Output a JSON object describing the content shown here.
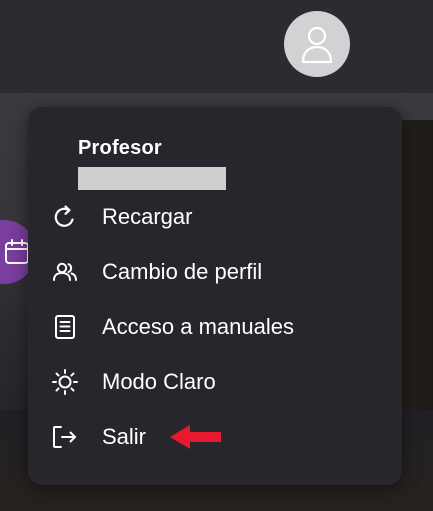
{
  "user": {
    "role": "Profesor"
  },
  "menu": {
    "items": [
      {
        "label": "Recargar",
        "icon": "reload-icon"
      },
      {
        "label": "Cambio de perfil",
        "icon": "users-icon"
      },
      {
        "label": "Acceso a manuales",
        "icon": "book-icon"
      },
      {
        "label": "Modo Claro",
        "icon": "sun-icon"
      },
      {
        "label": "Salir",
        "icon": "logout-icon"
      }
    ]
  },
  "colors": {
    "menu_bg": "#26262c",
    "accent_arrow": "#e8192c",
    "side_icon_bg": "#7a3e9e"
  }
}
